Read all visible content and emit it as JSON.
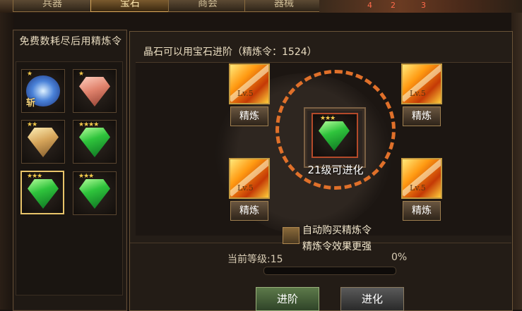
{
  "tabs": [
    {
      "label": "兵器",
      "active": false
    },
    {
      "label": "宝石",
      "active": true
    },
    {
      "label": "商会",
      "active": false
    },
    {
      "label": "器械",
      "active": false
    }
  ],
  "scene_numbers": [
    "4",
    "2",
    "3"
  ],
  "left_panel": {
    "title": "免费数耗尽后用精炼令",
    "gems": [
      {
        "type": "seal",
        "stars": 1,
        "badge": "斩",
        "selected": false
      },
      {
        "type": "salmon",
        "stars": 1,
        "selected": false
      },
      {
        "type": "gold",
        "stars": 2,
        "selected": false
      },
      {
        "type": "green",
        "stars": 4,
        "selected": false
      },
      {
        "type": "green",
        "stars": 3,
        "selected": true
      },
      {
        "type": "green",
        "stars": 3,
        "selected": false
      }
    ]
  },
  "main": {
    "title": "晶石可以用宝石进阶（精炼令：1524）",
    "center": {
      "gem": "green",
      "stars": 3,
      "status": "21级可进化"
    },
    "refine_slots": [
      {
        "level": "Lv.5",
        "button": "精炼"
      },
      {
        "level": "Lv.5",
        "button": "精炼"
      },
      {
        "level": "Lv.5",
        "button": "精炼"
      },
      {
        "level": "Lv.5",
        "button": "精炼"
      }
    ],
    "auto_buy": {
      "label": "自动购买精炼令",
      "subtext": "精炼令效果更强",
      "checked": false
    },
    "progress": {
      "level_text": "当前等级:15",
      "percent_text": "0%",
      "value": 0
    },
    "buttons": {
      "advance": "进阶",
      "evolve": "进化"
    }
  },
  "colors": {
    "accent_gold": "#e8c46a",
    "ring_orange": "#e0702a",
    "text_light": "#e9dcc0"
  }
}
